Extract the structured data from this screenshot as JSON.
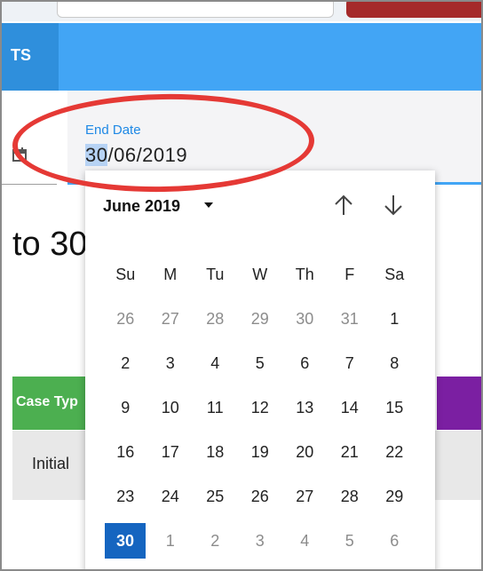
{
  "header": {
    "tab_label": "TS"
  },
  "end_date": {
    "label": "End Date",
    "value_selected": "30",
    "value_rest": "/06/2019"
  },
  "background": {
    "range_text": "to 30",
    "case_type_header": "Case Typ",
    "row_label": "Initial"
  },
  "calendar": {
    "month_label": "June 2019",
    "weekdays": [
      "Su",
      "M",
      "Tu",
      "W",
      "Th",
      "F",
      "Sa"
    ],
    "weeks": [
      [
        {
          "d": "26",
          "o": true
        },
        {
          "d": "27",
          "o": true
        },
        {
          "d": "28",
          "o": true
        },
        {
          "d": "29",
          "o": true
        },
        {
          "d": "30",
          "o": true
        },
        {
          "d": "31",
          "o": true
        },
        {
          "d": "1"
        }
      ],
      [
        {
          "d": "2"
        },
        {
          "d": "3"
        },
        {
          "d": "4"
        },
        {
          "d": "5"
        },
        {
          "d": "6"
        },
        {
          "d": "7"
        },
        {
          "d": "8"
        }
      ],
      [
        {
          "d": "9"
        },
        {
          "d": "10"
        },
        {
          "d": "11"
        },
        {
          "d": "12"
        },
        {
          "d": "13"
        },
        {
          "d": "14"
        },
        {
          "d": "15"
        }
      ],
      [
        {
          "d": "16"
        },
        {
          "d": "17"
        },
        {
          "d": "18"
        },
        {
          "d": "19"
        },
        {
          "d": "20"
        },
        {
          "d": "21"
        },
        {
          "d": "22"
        }
      ],
      [
        {
          "d": "23"
        },
        {
          "d": "24"
        },
        {
          "d": "25"
        },
        {
          "d": "26"
        },
        {
          "d": "27"
        },
        {
          "d": "28"
        },
        {
          "d": "29"
        }
      ],
      [
        {
          "d": "30",
          "s": true
        },
        {
          "d": "1",
          "o": true
        },
        {
          "d": "2",
          "o": true
        },
        {
          "d": "3",
          "o": true
        },
        {
          "d": "4",
          "o": true
        },
        {
          "d": "5",
          "o": true
        },
        {
          "d": "6",
          "o": true
        }
      ]
    ],
    "prev_icon": "arrow-up-icon",
    "next_icon": "arrow-down-icon"
  },
  "colors": {
    "accent_blue": "#42a5f5",
    "selected_day": "#1565c0",
    "annotation_red": "#e53935",
    "green_header": "#4caf50",
    "purple_header": "#7b1fa2"
  }
}
